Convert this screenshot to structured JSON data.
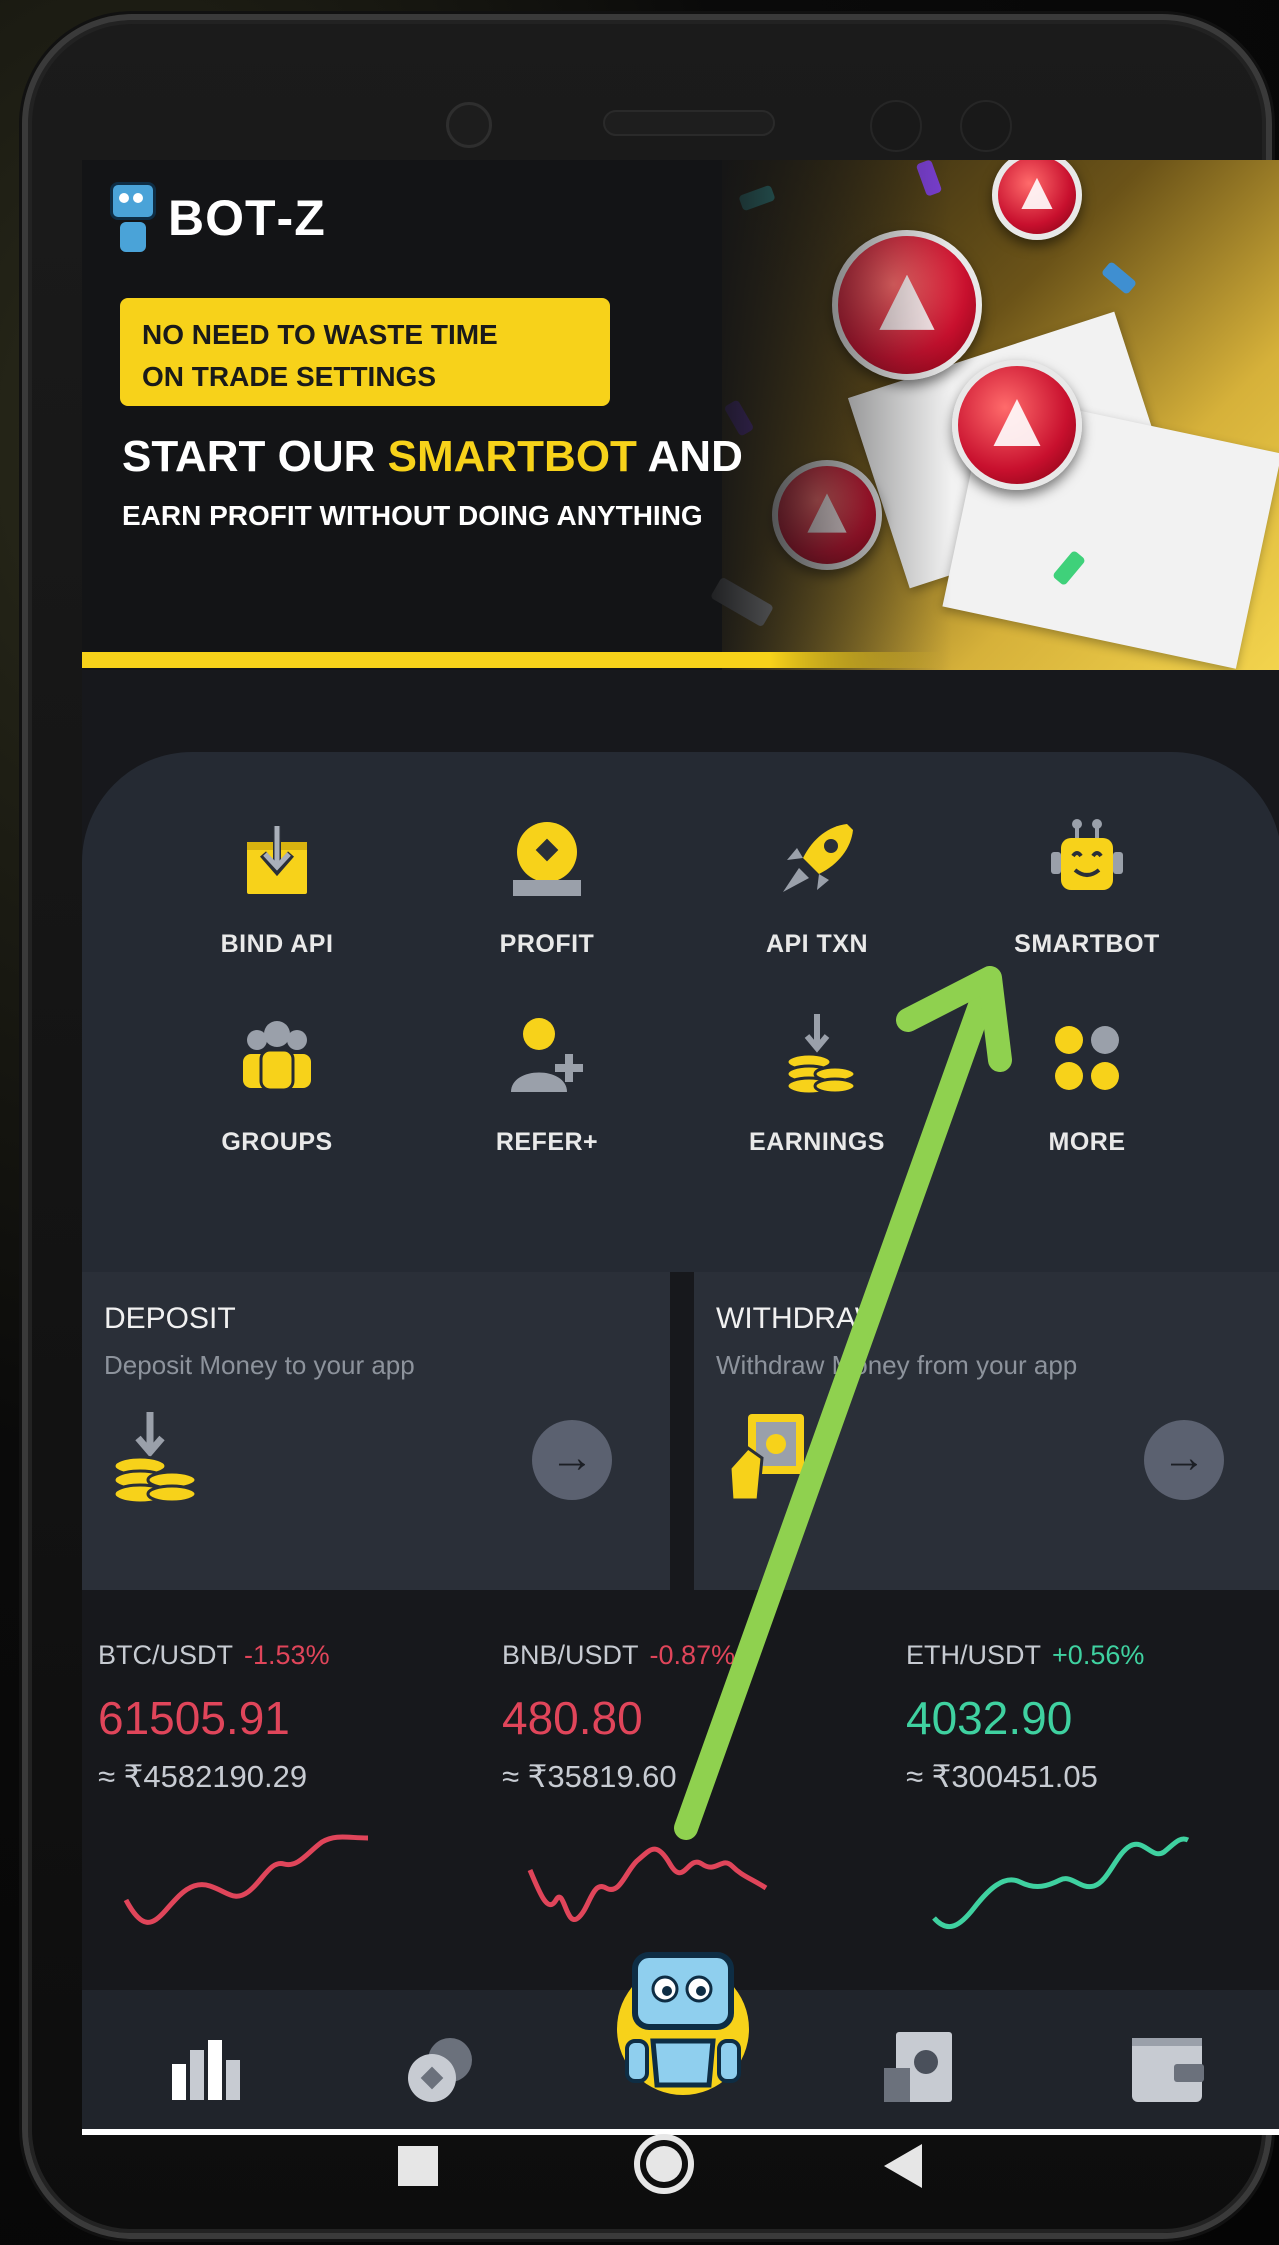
{
  "banner": {
    "logo_prefix": "BOT",
    "logo_suffix": "-Z",
    "tag_line1": "NO NEED TO WASTE TIME",
    "tag_line2": "ON TRADE SETTINGS",
    "headline_start": "START OUR ",
    "headline_highlight": "SMARTBOT",
    "headline_end": " AND",
    "subline": "EARN PROFIT WITHOUT  DOING ANYTHING"
  },
  "menu": {
    "items": [
      {
        "label": "BIND API",
        "icon": "bind-api-icon"
      },
      {
        "label": "PROFIT",
        "icon": "profit-icon"
      },
      {
        "label": "API TXN",
        "icon": "rocket-icon"
      },
      {
        "label": "SMARTBOT",
        "icon": "robot-icon"
      },
      {
        "label": "GROUPS",
        "icon": "groups-icon"
      },
      {
        "label": "REFER+",
        "icon": "refer-icon"
      },
      {
        "label": "EARNINGS",
        "icon": "coins-icon"
      },
      {
        "label": "MORE",
        "icon": "more-dots-icon"
      }
    ]
  },
  "cards": {
    "deposit": {
      "title": "DEPOSIT",
      "subtitle": "Deposit Money to your app"
    },
    "withdraw": {
      "title": "WITHDRAW",
      "subtitle": "Withdraw Money from your app"
    }
  },
  "tickers": [
    {
      "pair": "BTC/USDT",
      "change": "-1.53%",
      "price": "61505.91",
      "inr": "≈ ₹4582190.29",
      "direction": "down",
      "color": "#e0455a"
    },
    {
      "pair": "BNB/USDT",
      "change": "-0.87%",
      "price": "480.80",
      "inr": "≈ ₹35819.60",
      "direction": "down",
      "color": "#e0455a"
    },
    {
      "pair": "ETH/USDT",
      "change": "+0.56%",
      "price": "4032.90",
      "inr": "≈ ₹300451.05",
      "direction": "up",
      "color": "#3fd1a0"
    }
  ],
  "bottom_nav": {
    "icons": [
      "markets-icon",
      "coins-icon",
      "bot-home-icon",
      "deposit-icon",
      "wallet-icon"
    ]
  },
  "colors": {
    "accent": "#f7d21a",
    "down": "#e0455a",
    "up": "#3fd1a0",
    "annotation_arrow": "#8fd14f"
  }
}
